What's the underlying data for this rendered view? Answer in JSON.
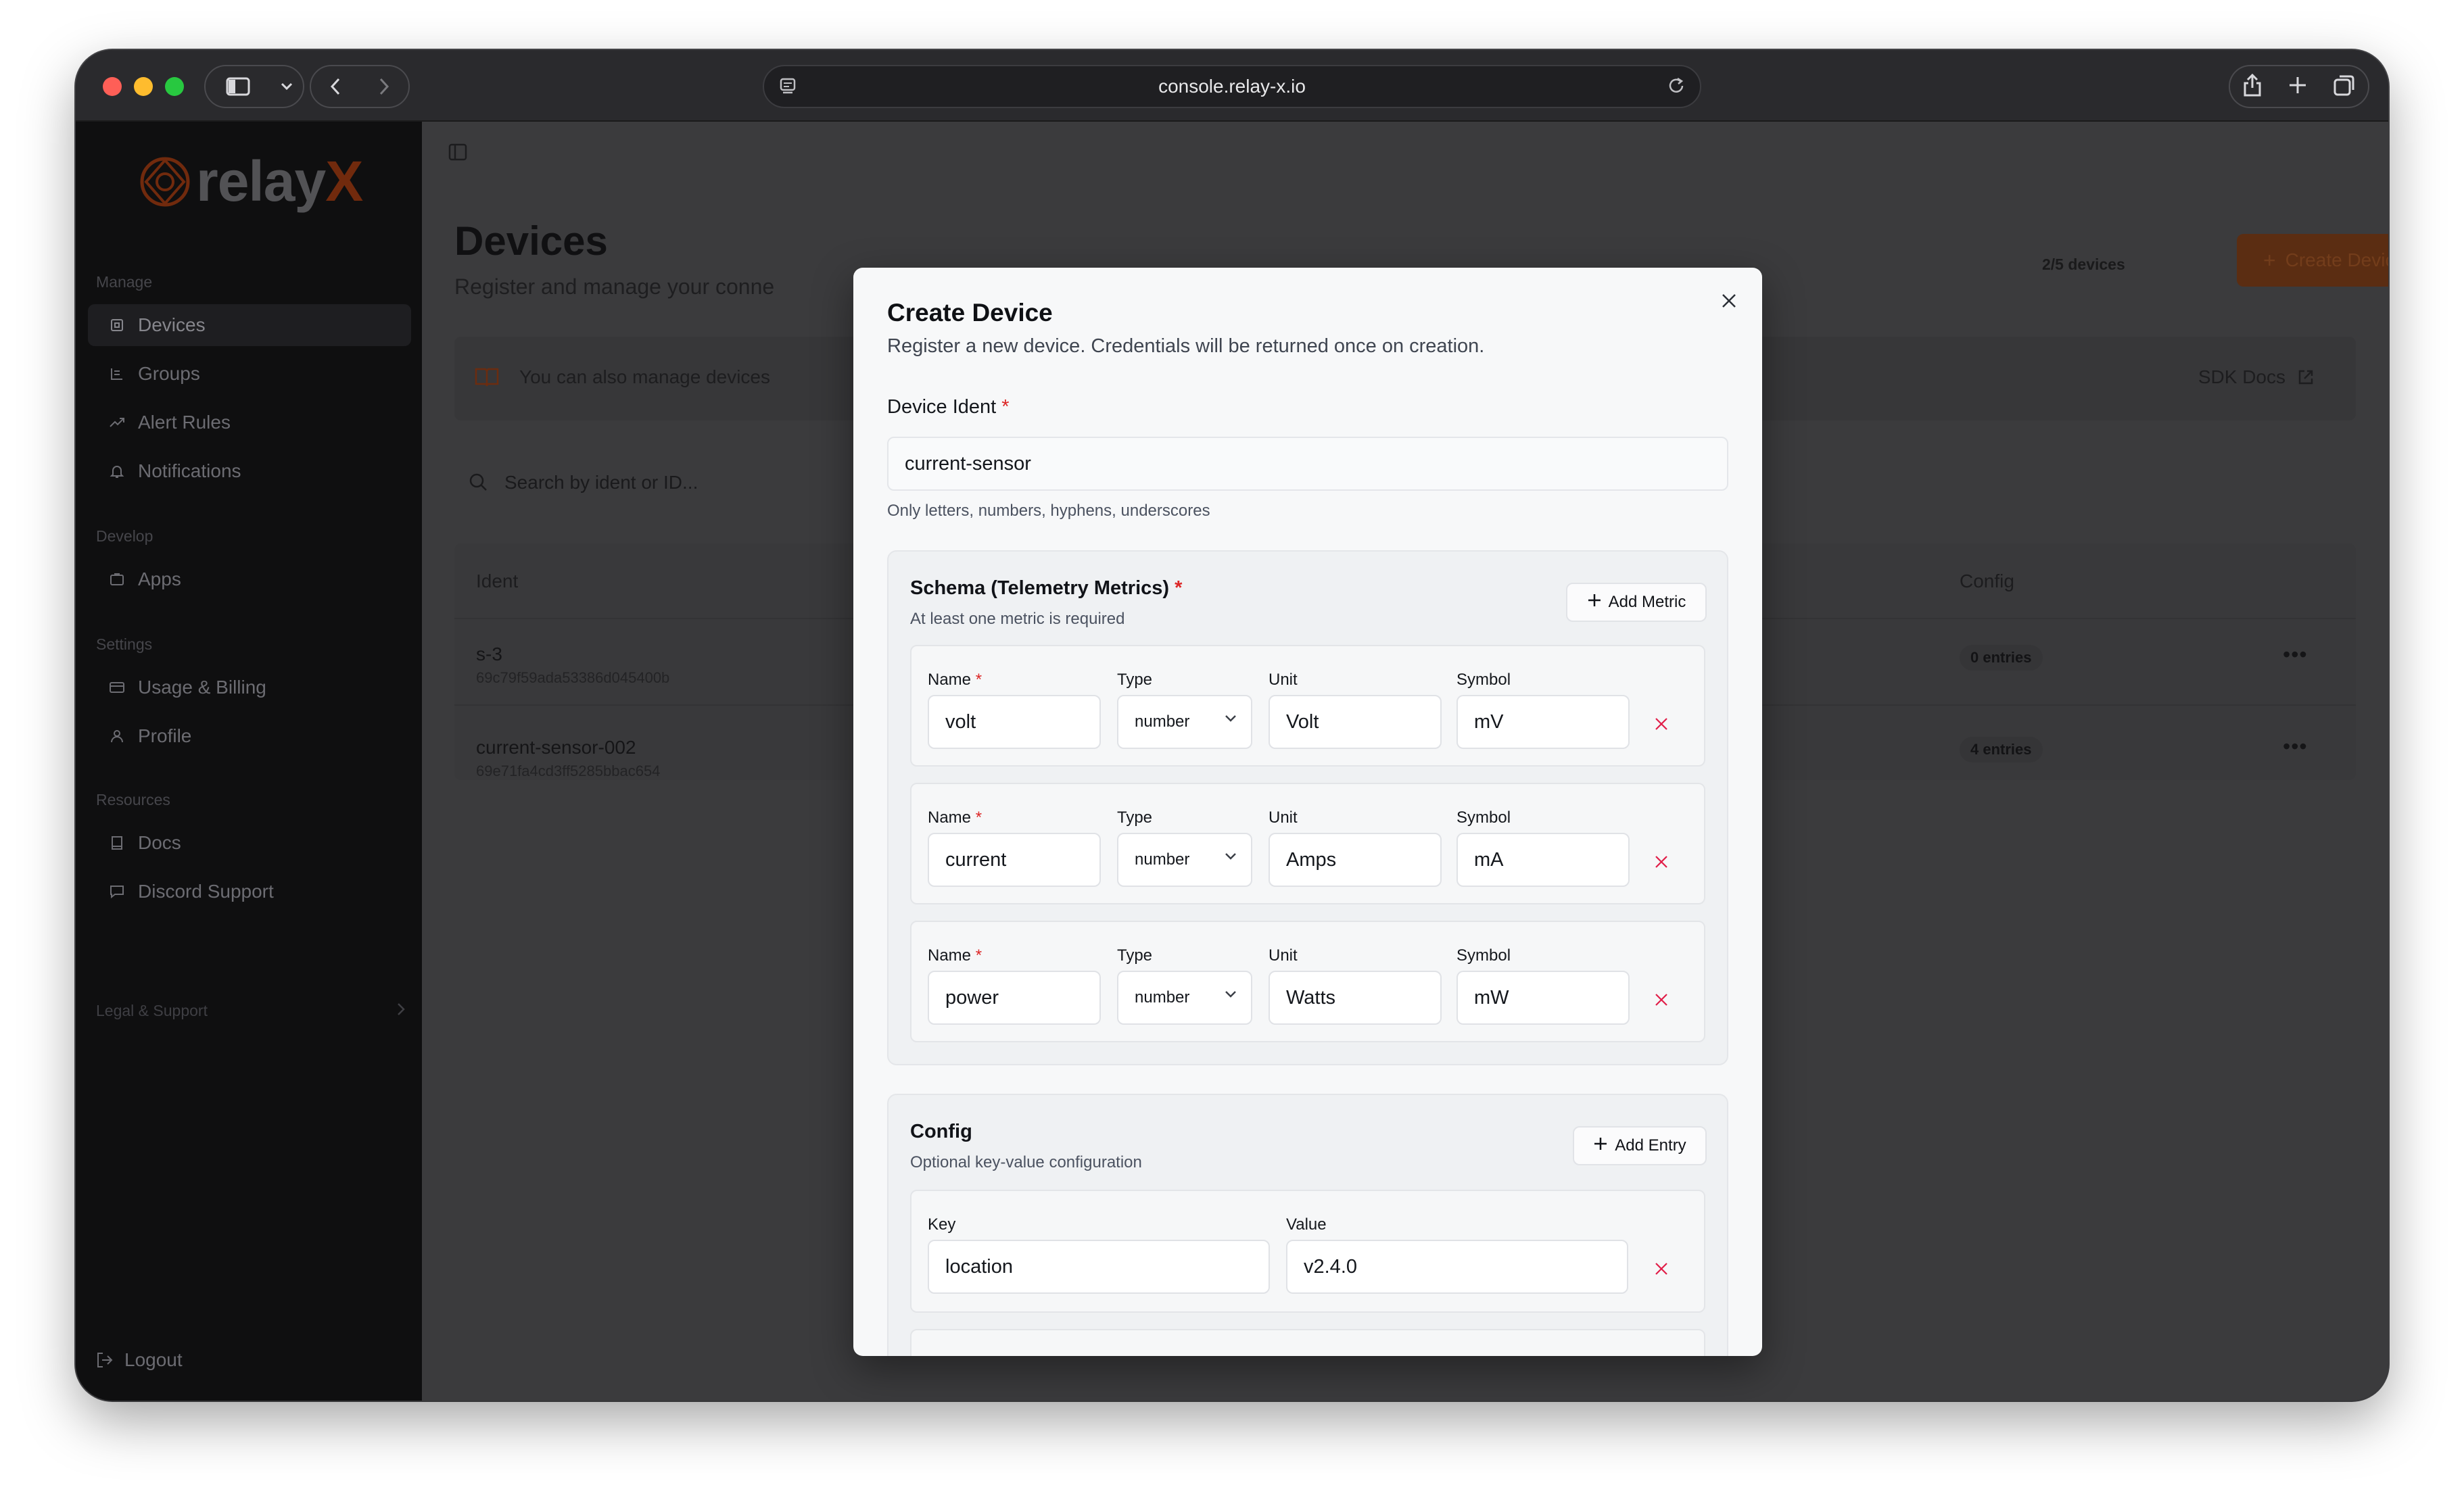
{
  "browser": {
    "url": "console.relay-x.io"
  },
  "sidebar": {
    "logo": {
      "text": "relay",
      "accent": "X"
    },
    "sections": [
      {
        "label": "Manage",
        "items": [
          {
            "label": "Devices",
            "icon": "chip-icon",
            "active": true
          },
          {
            "label": "Groups",
            "icon": "groups-icon"
          },
          {
            "label": "Alert Rules",
            "icon": "trend-icon"
          },
          {
            "label": "Notifications",
            "icon": "bell-icon"
          }
        ]
      },
      {
        "label": "Develop",
        "items": [
          {
            "label": "Apps",
            "icon": "folder-icon"
          }
        ]
      },
      {
        "label": "Settings",
        "items": [
          {
            "label": "Usage & Billing",
            "icon": "card-icon"
          },
          {
            "label": "Profile",
            "icon": "user-icon"
          }
        ]
      },
      {
        "label": "Resources",
        "items": [
          {
            "label": "Docs",
            "icon": "book-icon"
          },
          {
            "label": "Discord Support",
            "icon": "chat-icon"
          }
        ]
      }
    ],
    "legal_label": "Legal & Support",
    "logout_label": "Logout"
  },
  "page": {
    "title": "Devices",
    "subtitle": "Register and manage your conne",
    "device_count": "2/5 devices",
    "create_button": "Create Device",
    "info_text": "You can also manage devices",
    "sdk_docs": "SDK Docs",
    "search_placeholder": "Search by ident or ID...",
    "table": {
      "headers": {
        "ident": "Ident",
        "config": "Config"
      },
      "rows": [
        {
          "ident": "s-3",
          "id": "69c79f59ada53386d045400b",
          "config": "0 entries"
        },
        {
          "ident": "current-sensor-002",
          "id": "69e71fa4cd3ff5285bbac654",
          "config": "4 entries"
        }
      ]
    }
  },
  "modal": {
    "title": "Create Device",
    "description": "Register a new device. Credentials will be returned once on creation.",
    "device_ident_label": "Device Ident",
    "required_mark": "*",
    "device_ident_value": "current-sensor",
    "device_ident_hint": "Only letters, numbers, hyphens, underscores",
    "schema": {
      "title": "Schema (Telemetry Metrics)",
      "subtitle": "At least one metric is required",
      "add_button": "Add Metric",
      "field_labels": {
        "name": "Name",
        "type": "Type",
        "unit": "Unit",
        "symbol": "Symbol"
      },
      "metrics": [
        {
          "name": "volt",
          "type": "number",
          "unit": "Volt",
          "symbol": "mV"
        },
        {
          "name": "current",
          "type": "number",
          "unit": "Amps",
          "symbol": "mA"
        },
        {
          "name": "power",
          "type": "number",
          "unit": "Watts",
          "symbol": "mW"
        }
      ]
    },
    "config": {
      "title": "Config",
      "subtitle": "Optional key-value configuration",
      "add_button": "Add Entry",
      "field_labels": {
        "key": "Key",
        "value": "Value"
      },
      "entries": [
        {
          "key": "location",
          "value": "v2.4.0"
        }
      ]
    }
  },
  "colors": {
    "accent": "#c2410c",
    "required": "#dc2626",
    "remove": "#e11d48"
  }
}
